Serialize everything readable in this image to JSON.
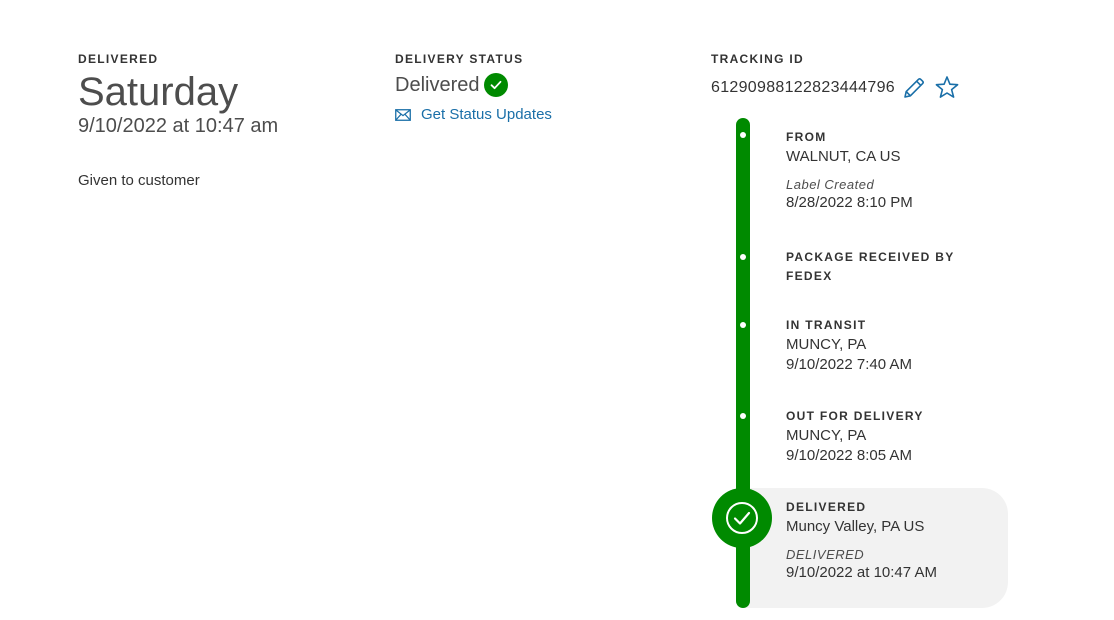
{
  "delivered_panel": {
    "label": "DELIVERED",
    "day": "Saturday",
    "datetime": "9/10/2022 at 10:47 am",
    "note": "Given to customer"
  },
  "status_panel": {
    "label": "DELIVERY STATUS",
    "status": "Delivered",
    "updates_link": "Get Status Updates"
  },
  "tracking_panel": {
    "label": "TRACKING ID",
    "tracking_id": "612909881228234447​96"
  },
  "timeline": {
    "events": [
      {
        "title": "FROM",
        "location": "WALNUT, CA US",
        "sub": "Label Created",
        "time": "8/28/2022 8:10 PM"
      },
      {
        "title": "PACKAGE RECEIVED BY FEDEX"
      },
      {
        "title": "IN TRANSIT",
        "location": "MUNCY, PA",
        "time": "9/10/2022 7:40 AM"
      },
      {
        "title": "OUT FOR DELIVERY",
        "location": "MUNCY, PA",
        "time": "9/10/2022 8:05 AM"
      },
      {
        "title": "DELIVERED",
        "location": "Muncy Valley, PA US",
        "sub": "DELIVERED",
        "time": "9/10/2022 at 10:47 AM"
      }
    ]
  },
  "colors": {
    "accent_green": "#008a00",
    "link_blue": "#1a6fa8",
    "highlight_bg": "#f2f2f2"
  },
  "icons": [
    "check-circle-icon",
    "envelope-icon",
    "pencil-icon",
    "star-icon",
    "timeline-check-icon"
  ]
}
